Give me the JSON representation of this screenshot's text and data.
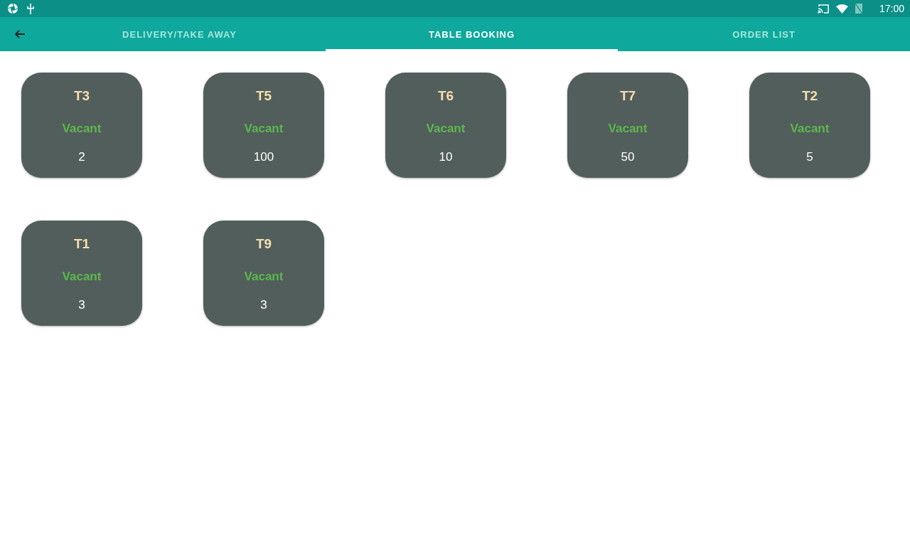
{
  "status_bar": {
    "time": "17:00"
  },
  "tabs": [
    {
      "label": "DELIVERY/TAKE AWAY",
      "selected": false
    },
    {
      "label": "TABLE BOOKING",
      "selected": true
    },
    {
      "label": "ORDER LIST",
      "selected": false
    }
  ],
  "tables": [
    {
      "name": "T3",
      "status": "Vacant",
      "kind": "vacant",
      "capacity": "2"
    },
    {
      "name": "T5",
      "status": "Vacant",
      "kind": "vacant",
      "capacity": "100"
    },
    {
      "name": "T6",
      "status": "Vacant",
      "kind": "vacant",
      "capacity": "10"
    },
    {
      "name": "T7",
      "status": "Vacant",
      "kind": "vacant",
      "capacity": "50"
    },
    {
      "name": "T2",
      "status": "Vacant",
      "kind": "vacant",
      "capacity": "5"
    },
    {
      "name": "T1",
      "status": "Vacant",
      "kind": "vacant",
      "capacity": "3"
    },
    {
      "name": "T9",
      "status": "Vacant",
      "kind": "vacant",
      "capacity": "3"
    }
  ]
}
